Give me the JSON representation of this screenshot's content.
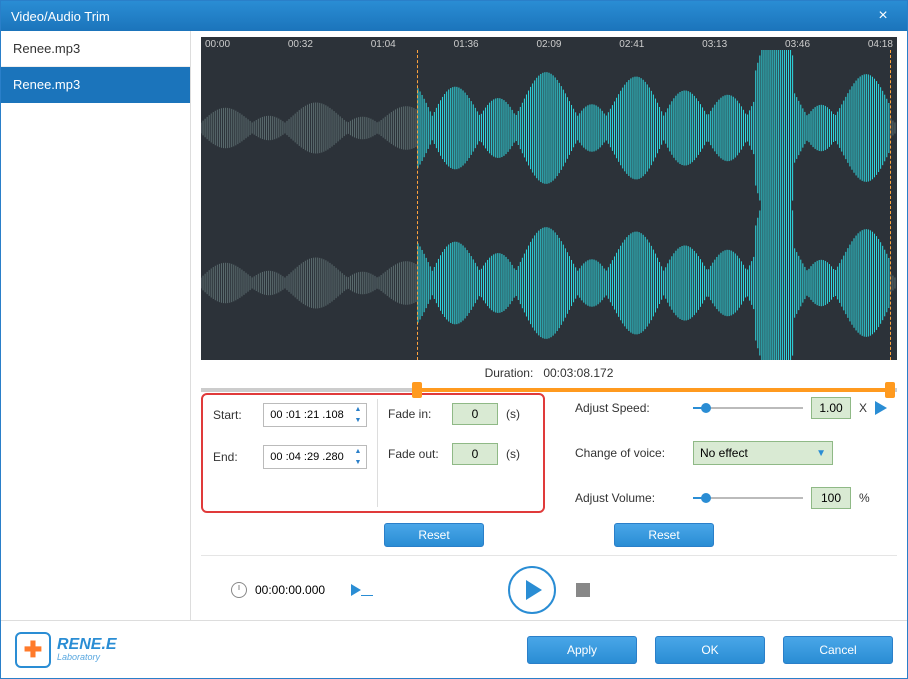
{
  "title": "Video/Audio Trim",
  "sidebar": {
    "items": [
      {
        "label": "Renee.mp3",
        "selected": false
      },
      {
        "label": "Renee.mp3",
        "selected": true
      }
    ]
  },
  "timeline": {
    "ticks": [
      "00:00",
      "00:32",
      "01:04",
      "01:36",
      "02:09",
      "02:41",
      "03:13",
      "03:46",
      "04:18"
    ],
    "selection_start_pct": 31,
    "selection_end_pct": 99
  },
  "duration": {
    "label": "Duration:",
    "value": "00:03:08.172"
  },
  "trim": {
    "start_label": "Start:",
    "start_value": "00 :01 :21 .108",
    "end_label": "End:",
    "end_value": "00 :04 :29 .280"
  },
  "fade": {
    "in_label": "Fade in:",
    "in_value": "0",
    "out_label": "Fade out:",
    "out_value": "0",
    "unit": "(s)"
  },
  "reset_label": "Reset",
  "speed": {
    "label": "Adjust Speed:",
    "value": "1.00",
    "x": "X",
    "pct": 12
  },
  "voice": {
    "label": "Change of voice:",
    "value": "No effect"
  },
  "volume": {
    "label": "Adjust Volume:",
    "value": "100",
    "unit": "%",
    "pct": 12
  },
  "player": {
    "time": "00:00:00.000"
  },
  "logo": {
    "line1": "RENE.E",
    "line2": "Laboratory"
  },
  "footer": {
    "apply": "Apply",
    "ok": "OK",
    "cancel": "Cancel"
  }
}
